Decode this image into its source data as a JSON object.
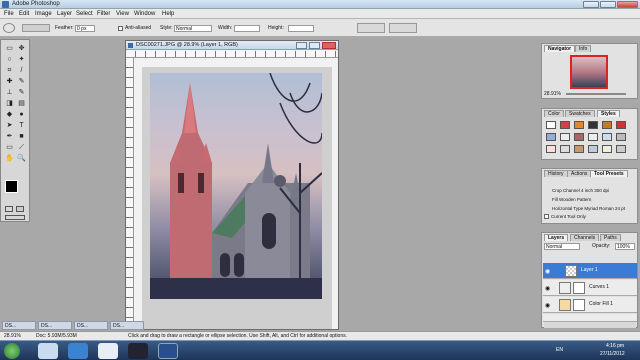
{
  "window": {
    "title": "Adobe Photoshop"
  },
  "menu": [
    "File",
    "Edit",
    "Image",
    "Layer",
    "Select",
    "Filter",
    "View",
    "Window",
    "Help"
  ],
  "options": {
    "feather_label": "Feather:",
    "feather_value": "0 px",
    "antialiased_label": "Anti-aliased",
    "style_label": "Style:",
    "style_value": "Normal",
    "width_label": "Width:",
    "height_label": "Height:"
  },
  "document": {
    "title": "DSC00271.JPG @ 28.9% (Layer 1, RGB)"
  },
  "navigator": {
    "tabs": [
      "Navigator",
      "Info"
    ],
    "zoom": "28.91%"
  },
  "color_panel": {
    "tabs": [
      "Color",
      "Swatches",
      "Styles"
    ]
  },
  "history_panel": {
    "tabs": [
      "History",
      "Actions",
      "Tool Presets"
    ],
    "items": [
      "Crop Channel 4 inch 300 dpi",
      "Fill Wooden Pattern",
      "Horizontal Type Myriad Roman 24 pt",
      "Current Tool Only"
    ]
  },
  "layers_panel": {
    "tabs": [
      "Layers",
      "Channels",
      "Paths"
    ],
    "mode": "Normal",
    "opacity_label": "Opacity:",
    "opacity_value": "100%",
    "layers": [
      {
        "name": "Layer 1",
        "selected": true
      },
      {
        "name": "Curves 1",
        "selected": false
      },
      {
        "name": "Color Fill 1",
        "selected": false
      },
      {
        "name": "",
        "selected": false
      }
    ]
  },
  "status_bar": {
    "zoom": "28.91%",
    "doc": "Doc: 5.93M/5.93M",
    "hint": "Click and drag to draw a rectangle or ellipse selection. Use Shift, Alt, and Ctrl for additional options."
  },
  "minimized_docs": [
    "DS...",
    "DS...",
    "DS...",
    "DS...",
    "DS..."
  ],
  "clock": {
    "time": "4:16 pm",
    "date": "27/11/2012"
  },
  "tray": {
    "lang": "EN"
  },
  "colors": {
    "selection": "#3a7bd5",
    "taskbar": "#2a4670"
  }
}
